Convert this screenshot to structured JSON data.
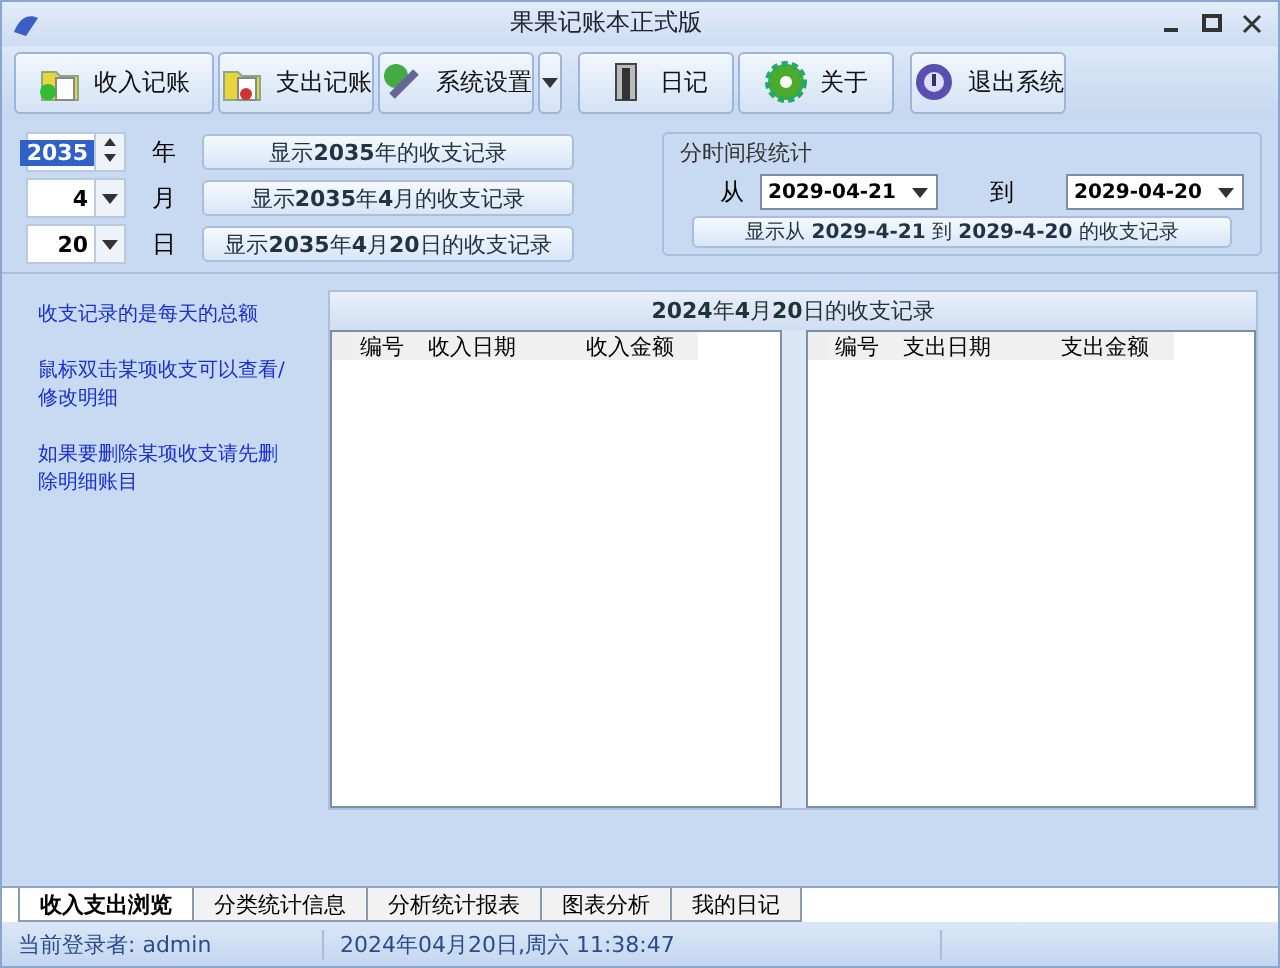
{
  "window": {
    "title": "果果记账本正式版"
  },
  "toolbar": [
    {
      "label": "收入记账",
      "kind": "button"
    },
    {
      "label": "支出记账",
      "kind": "button"
    },
    {
      "label": "系统设置",
      "kind": "button"
    },
    {
      "kind": "dropdown"
    },
    {
      "label": "日记",
      "kind": "button"
    },
    {
      "label": "关于",
      "kind": "button"
    },
    {
      "label": "退出系统",
      "kind": "button"
    }
  ],
  "date_rows": [
    {
      "value": "2035",
      "kind": "spin",
      "highlighted": true,
      "unit": "年",
      "button": "显示**2035**年的收支记录"
    },
    {
      "value": "4",
      "kind": "dropdown",
      "highlighted": false,
      "unit": "月",
      "button": "显示**2035**年**4**月的收支记录"
    },
    {
      "value": "20",
      "kind": "dropdown",
      "highlighted": false,
      "unit": "日",
      "button": "显示**2035**年**4**月**20**日的收支记录"
    }
  ],
  "range": {
    "title": "分时间段统计",
    "from_label": "从",
    "from": "2029-04-21",
    "to_label": "到",
    "to": "2029-04-20",
    "button": "显示从 **2029-4-21** 到 **2029-4-20** 的收支记录"
  },
  "notes": [
    "收支记录的是每天的总额",
    "鼠标双击某项收支可以查看/修改明细",
    "如果要删除某项收支请先删除明细账目"
  ],
  "records": {
    "title": "**2024**年**4**月**20**日的收支记录",
    "tables": [
      {
        "columns": [
          "编号",
          "收入日期",
          "收入金额"
        ]
      },
      {
        "columns": [
          "编号",
          "支出日期",
          "支出金额"
        ]
      }
    ]
  },
  "tabs": [
    {
      "label": "收入支出浏览",
      "selected": true
    },
    {
      "label": "分类统计信息",
      "selected": false
    },
    {
      "label": "分析统计报表",
      "selected": false
    },
    {
      "label": "图表分析",
      "selected": false
    },
    {
      "label": "我的日记",
      "selected": false
    }
  ],
  "status_bar": [
    "当前登录者: admin",
    "2024年04月20日,周六 11:38:47"
  ]
}
